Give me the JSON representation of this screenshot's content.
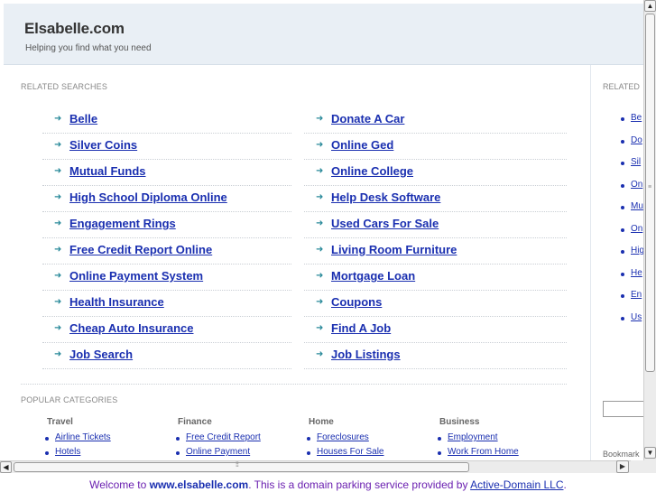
{
  "header": {
    "title": "Elsabelle.com",
    "tagline": "Helping you find what you need"
  },
  "related": {
    "label": "RELATED SEARCHES",
    "left": [
      "Belle",
      "Silver Coins",
      "Mutual Funds",
      "High School Diploma Online",
      "Engagement Rings",
      "Free Credit Report Online",
      "Online Payment System",
      "Health Insurance",
      "Cheap Auto Insurance",
      "Job Search"
    ],
    "right": [
      "Donate A Car",
      "Online Ged",
      "Online College",
      "Help Desk Software",
      "Used Cars For Sale",
      "Living Room Furniture",
      "Mortgage Loan",
      "Coupons",
      "Find A Job",
      "Job Listings"
    ]
  },
  "popular": {
    "label": "POPULAR CATEGORIES",
    "categories": [
      {
        "title": "Travel",
        "items": [
          "Airline Tickets",
          "Hotels"
        ]
      },
      {
        "title": "Finance",
        "items": [
          "Free Credit Report",
          "Online Payment"
        ]
      },
      {
        "title": "Home",
        "items": [
          "Foreclosures",
          "Houses For Sale"
        ]
      },
      {
        "title": "Business",
        "items": [
          "Employment",
          "Work From Home"
        ]
      }
    ]
  },
  "sidebar": {
    "label": "RELATED",
    "items": [
      "Be",
      "Do",
      "Sil",
      "On",
      "Mu",
      "On",
      "Hig",
      "He",
      "En",
      "Us"
    ],
    "bookmark": "Bookmark"
  },
  "footer": {
    "prefix": "Welcome to ",
    "site": "www.elsabelle.com",
    "middle": ". This is a domain parking service provided by ",
    "provider": "Active-Domain LLC",
    "suffix": "."
  },
  "icons": {
    "arrow": "arrow-right-icon",
    "bullet": "bullet-icon"
  },
  "colors": {
    "link": "#1a2fb0",
    "header_bg": "#e9eff5",
    "arrow": "#2a8a9a"
  }
}
